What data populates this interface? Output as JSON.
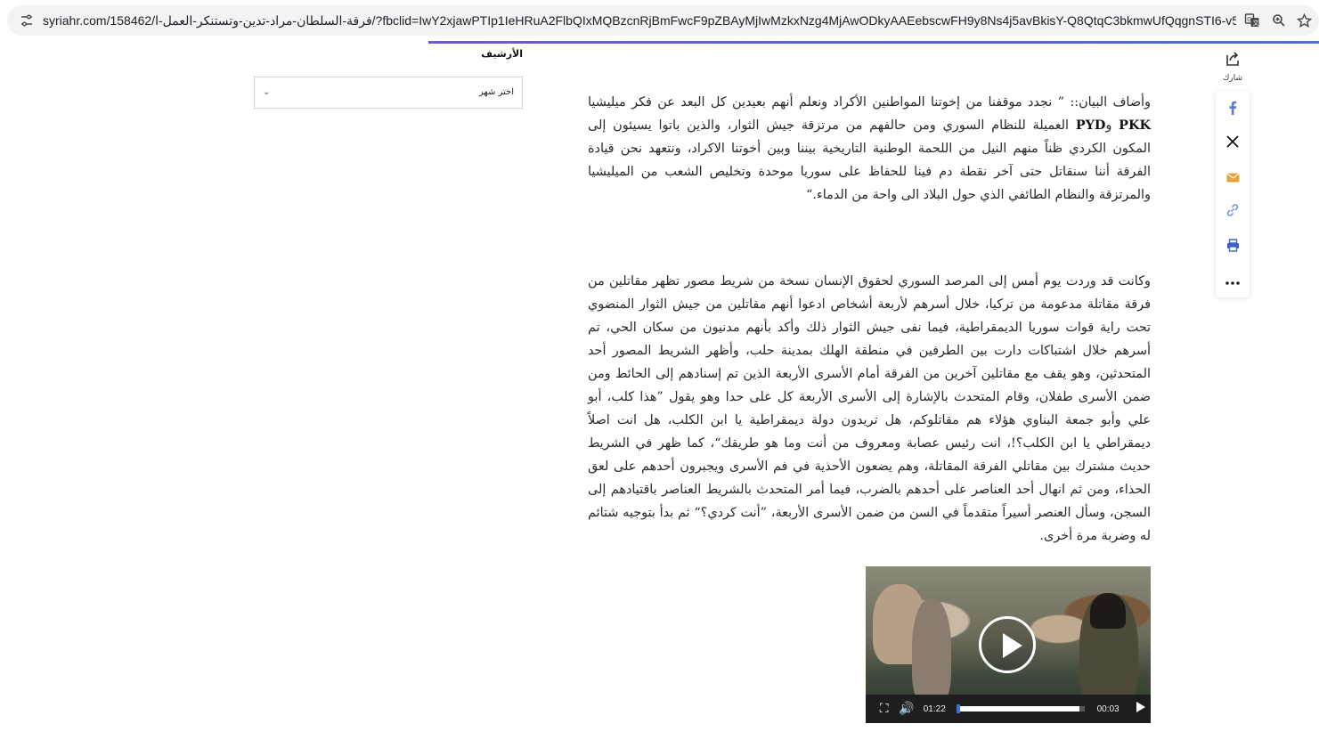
{
  "browser": {
    "url": "syriahr.com/158462/فرقة-السلطان-مراد-تدين-وتستنكر-العمل-ا/?fbclid=IwY2xjawPTIp1IeHRuA2FlbQIxMQBzcnRjBmFwcF9pZBAyMjIwMzkxNzg4MjAwODkyAAEebscwFH9y8Ns4j5avBkisY-Q8QtqC3bkmwUfQqgnSTI6-v5P...",
    "site_info_icon": "tune-icon",
    "translate_icon": "translate-icon",
    "zoom_icon": "zoom-icon",
    "bookmark_icon": "star-icon"
  },
  "sidebar": {
    "archive_title": "الأرشيف",
    "select_placeholder": "اختر شهر"
  },
  "share": {
    "label": "شارك",
    "buttons": [
      {
        "name": "facebook",
        "color": "#5b7bd5"
      },
      {
        "name": "x",
        "color": "#111111"
      },
      {
        "name": "email",
        "color": "#e8a13a"
      },
      {
        "name": "copy-link",
        "color": "#6a8ee6"
      },
      {
        "name": "print",
        "color": "#3b62c4"
      },
      {
        "name": "more",
        "color": "#222222"
      }
    ]
  },
  "article": {
    "p1_before": "وأضاف البيان:: ” نجدد موقفنا من إخوتنا المواطنين الأكراد ونعلم أنهم بعيدين كل البعد عن فكر ميليشيا ",
    "p1_bold1": "PKK",
    "p1_mid": " و",
    "p1_bold2": "PYD",
    "p1_after": " العميلة للنظام السوري ومن حالفهم من مرتزقة جيش الثوار، والذين باتوا يسيئون إلى المكون الكردي ظناً منهم النيل من اللحمة الوطنية التاريخية بيننا وبين أخوتنا الاكراد، ونتعهد نحن قيادة الفرقة أننا سنقاتل حتى آخر نقطة دم فينا للحفاظ على سوريا موحدة وتخليص الشعب من الميليشيا والمرتزقة والنظام الطائفي الذي حول البلاد الى واحة من الدماء.“",
    "p2": "وكانت قد وردت  يوم أمس إلى المرصد السوري لحقوق الإنسان نسخة من شريط مصور تظهر مقاتلين من فرقة مقاتلة مدعومة من تركيا، خلال أسرهم لأربعة أشخاص ادعوا أنهم مقاتلين من جيش الثوار المنضوي تحت راية قوات سوريا الديمقراطية، فيما نفى جيش الثوار ذلك وأكد بأنهم مدنيون من سكان الحي، تم أسرهم خلال اشتباكات دارت بين الطرفين في منطقة الهلك بمدينة حلب، وأظهر الشريط المصور أحد المتحدثين، وهو يقف مع مقاتلين آخرين من الفرقة أمام الأسرى الأربعة الذين تم إسنادهم إلى الحائط ومن ضمن الأسرى طفلان، وقام المتحدث بالإشارة إلى الأسرى الأربعة كل على حدا وهو يقول ”هذا كلب، أبو علي وأبو جمعة البناوي هؤلاء هم مقاتلوكم، هل تريدون دولة ديمقراطية يا ابن الكلب، هل انت اصلاً ديمقراطي يا ابن الكلب؟!، انت رئيس عصابة ومعروف من أنت وما هو طريقك“، كما ظهر في الشريط حديث مشترك بين مقاتلي الفرقة المقاتلة، وهم يضعون الأحذية في فم الأسرى ويجبرون أحدهم على لعق الحذاء، ومن ثم انهال أحد العناصر على أحدهم بالضرب، فيما أمر المتحدث بالشريط العناصر باقتيادهم إلى السجن، وسأل العنصر أسيراً متقدماً في السن من ضمن الأسرى الأربعة، ”أنت كردي؟“ ثم بدأ بتوجيه شتائم له وضربة مرة أخرى."
  },
  "video": {
    "elapsed": "01:22",
    "remaining": "00:03",
    "progress_fraction": 0.96
  }
}
